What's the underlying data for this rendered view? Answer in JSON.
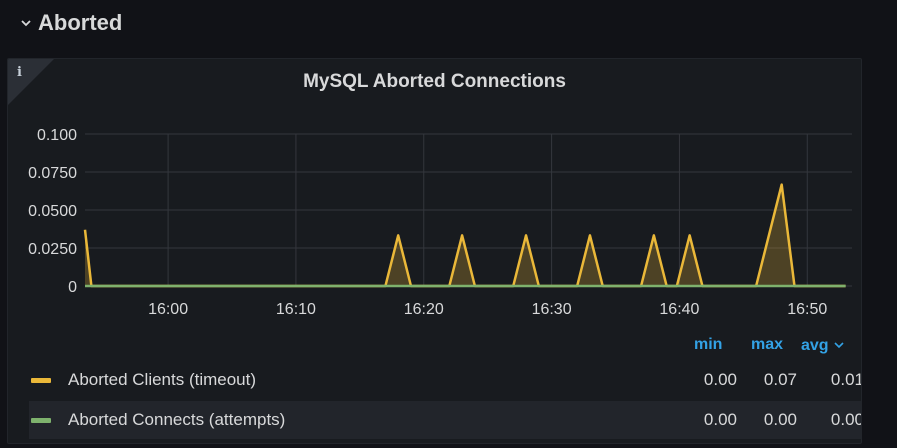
{
  "row": {
    "title": "Aborted",
    "chevron_icon": "chevron-down-icon"
  },
  "panel": {
    "title": "MySQL Aborted Connections",
    "info_icon": "i"
  },
  "chart_data": {
    "type": "line",
    "title": "MySQL Aborted Connections",
    "y_ticks": [
      "0.100",
      "0.0750",
      "0.0500",
      "0.0250",
      "0"
    ],
    "x_ticks": [
      "16:00",
      "16:10",
      "16:20",
      "16:30",
      "16:40",
      "16:50"
    ],
    "ylim": [
      0,
      0.1
    ],
    "xlim_minutes": [
      -6.5,
      53.5
    ],
    "grid": true,
    "series": [
      {
        "name": "Aborted Clients (timeout)",
        "color": "#eab839",
        "points": [
          [
            -6.5,
            0.037
          ],
          [
            -6.0,
            0
          ],
          [
            17.0,
            0
          ],
          [
            18.0,
            0.0333
          ],
          [
            19.0,
            0
          ],
          [
            22.0,
            0
          ],
          [
            23.0,
            0.0333
          ],
          [
            24.0,
            0
          ],
          [
            27.0,
            0
          ],
          [
            28.0,
            0.0333
          ],
          [
            29.0,
            0
          ],
          [
            32.0,
            0
          ],
          [
            33.0,
            0.0333
          ],
          [
            34.0,
            0
          ],
          [
            37.0,
            0
          ],
          [
            38.0,
            0.0333
          ],
          [
            39.0,
            0
          ],
          [
            39.8,
            0
          ],
          [
            40.8,
            0.0333
          ],
          [
            41.8,
            0
          ],
          [
            46.0,
            0
          ],
          [
            48.0,
            0.0667
          ],
          [
            49.0,
            0
          ],
          [
            53.0,
            0
          ]
        ]
      },
      {
        "name": "Aborted Connects (attempts)",
        "color": "#7eb26d",
        "points": [
          [
            -6.5,
            0
          ],
          [
            53.0,
            0
          ]
        ]
      }
    ]
  },
  "legend": {
    "headers": {
      "min": "min",
      "max": "max",
      "avg": "avg"
    },
    "sort_icon": "chevron-down-icon",
    "rows": [
      {
        "name": "Aborted Clients (timeout)",
        "color": "#eab839",
        "min": "0.00",
        "max": "0.07",
        "avg": "0.01"
      },
      {
        "name": "Aborted Connects (attempts)",
        "color": "#7eb26d",
        "min": "0.00",
        "max": "0.00",
        "avg": "0.00"
      }
    ]
  }
}
